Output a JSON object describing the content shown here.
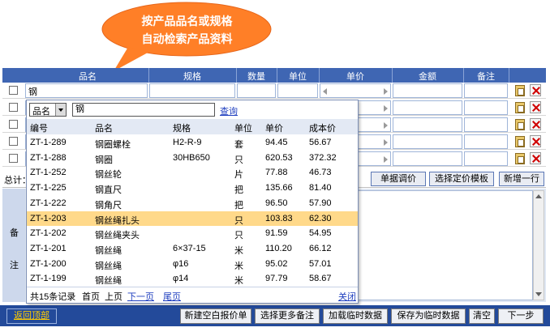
{
  "callout": {
    "line1": "按产品品名或规格",
    "line2": "自动检索产品资料",
    "color": "#ff7f27"
  },
  "grid": {
    "headers": [
      "品名",
      "规格",
      "数量",
      "单位",
      "单价",
      "金额",
      "备注"
    ],
    "first_row_input": "钢",
    "row_count": 5
  },
  "totals": {
    "label": "总计："
  },
  "toolbar": {
    "adjust_price": "单据调价",
    "select_template": "选择定价模板",
    "add_row": "新增一行"
  },
  "notes": {
    "label_top": "备",
    "label_bottom": "注"
  },
  "bottom": {
    "back_top": "返回顶部",
    "new_blank": "新建空白报价单",
    "more_notes": "选择更多备注",
    "load_temp": "加载临时数据",
    "save_temp": "保存为临时数据",
    "clear": "清空",
    "next": "下一步"
  },
  "popup": {
    "field_select": "品名",
    "search_value": "钢",
    "query": "查询",
    "columns": [
      "编号",
      "品名",
      "规格",
      "单位",
      "单价",
      "成本价"
    ],
    "rows": [
      {
        "code": "ZT-1-289",
        "name": "钢圈螺栓",
        "spec": "H2-R-9",
        "unit": "套",
        "price": "94.45",
        "cost": "56.67"
      },
      {
        "code": "ZT-1-288",
        "name": "钢圈",
        "spec": "30HB650",
        "unit": "只",
        "price": "620.53",
        "cost": "372.32"
      },
      {
        "code": "ZT-1-252",
        "name": "钢丝轮",
        "spec": "",
        "unit": "片",
        "price": "77.88",
        "cost": "46.73"
      },
      {
        "code": "ZT-1-225",
        "name": "钢直尺",
        "spec": "",
        "unit": "把",
        "price": "135.66",
        "cost": "81.40"
      },
      {
        "code": "ZT-1-222",
        "name": "钢角尺",
        "spec": "",
        "unit": "把",
        "price": "96.50",
        "cost": "57.90"
      },
      {
        "code": "ZT-1-203",
        "name": "钢丝绳扎头",
        "spec": "",
        "unit": "只",
        "price": "103.83",
        "cost": "62.30"
      },
      {
        "code": "ZT-1-202",
        "name": "钢丝绳夹头",
        "spec": "",
        "unit": "只",
        "price": "91.59",
        "cost": "54.95"
      },
      {
        "code": "ZT-1-201",
        "name": "钢丝绳",
        "spec": "6×37-15",
        "unit": "米",
        "price": "110.20",
        "cost": "66.12"
      },
      {
        "code": "ZT-1-200",
        "name": "钢丝绳",
        "spec": "φ16",
        "unit": "米",
        "price": "95.02",
        "cost": "57.01"
      },
      {
        "code": "ZT-1-199",
        "name": "钢丝绳",
        "spec": "φ14",
        "unit": "米",
        "price": "97.79",
        "cost": "58.67"
      }
    ],
    "highlight_index": 5,
    "footer": {
      "total": "共15条记录",
      "first": "首页",
      "prev": "上页",
      "next": "下一页",
      "last": "尾页",
      "close": "关闭"
    }
  }
}
